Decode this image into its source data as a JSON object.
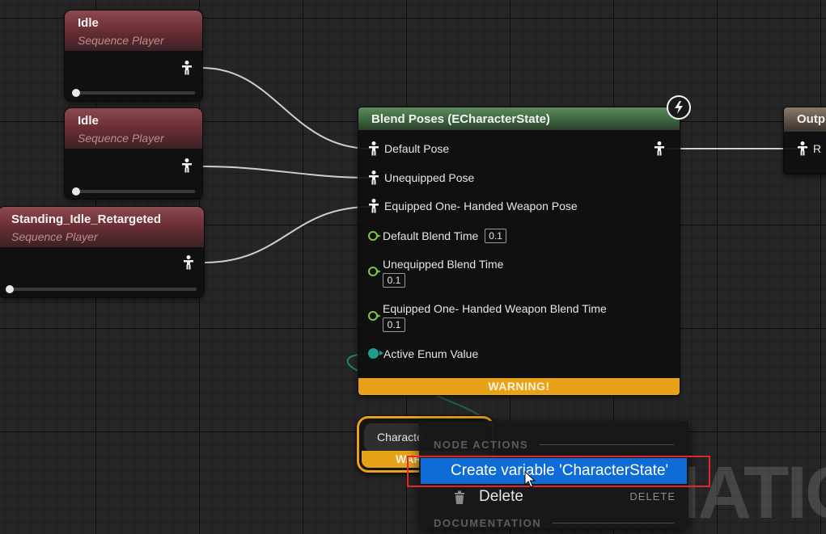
{
  "sequence_players": [
    {
      "title": "Idle",
      "subtitle": "Sequence Player"
    },
    {
      "title": "Idle",
      "subtitle": "Sequence Player"
    },
    {
      "title": "Standing_Idle_Retargeted",
      "subtitle": "Sequence Player"
    }
  ],
  "blend_node": {
    "title": "Blend Poses (ECharacterState)",
    "pins": {
      "default_pose": "Default Pose",
      "unequipped_pose": "Unequipped Pose",
      "equipped_pose": "Equipped One- Handed Weapon Pose",
      "default_blend_time": "Default Blend Time",
      "default_blend_time_value": "0.1",
      "unequipped_blend_time": "Unequipped Blend Time",
      "unequipped_blend_time_value": "0.1",
      "equipped_blend_time": "Equipped One- Handed Weapon Blend Time",
      "equipped_blend_time_value": "0.1",
      "active_enum_value": "Active Enum Value"
    },
    "warning": "WARNING!"
  },
  "output_node": {
    "title": "Outp",
    "pin_label": "R"
  },
  "character_state_node": {
    "label": "Characte",
    "warning": "WAR"
  },
  "context_menu": {
    "section_node_actions": "NODE ACTIONS",
    "create_variable": "Create variable 'CharacterState'",
    "delete": "Delete",
    "delete_shortcut": "DELETE",
    "section_documentation": "DOCUMENTATION"
  },
  "watermark": "IATIO",
  "colors": {
    "sequence_header": "#6e2f36",
    "blend_header": "#3f6a42",
    "warning": "#e8a21a",
    "menu_highlight": "#0f6cd6",
    "annotation_box": "#e3262e",
    "exec_pin": "#7ec64a",
    "enum_pin": "#1f9c8c"
  },
  "icons": [
    "pose-pin-icon",
    "exec-pin-icon",
    "enum-pin-icon",
    "lightning-icon",
    "trash-icon",
    "mouse-cursor-icon"
  ]
}
